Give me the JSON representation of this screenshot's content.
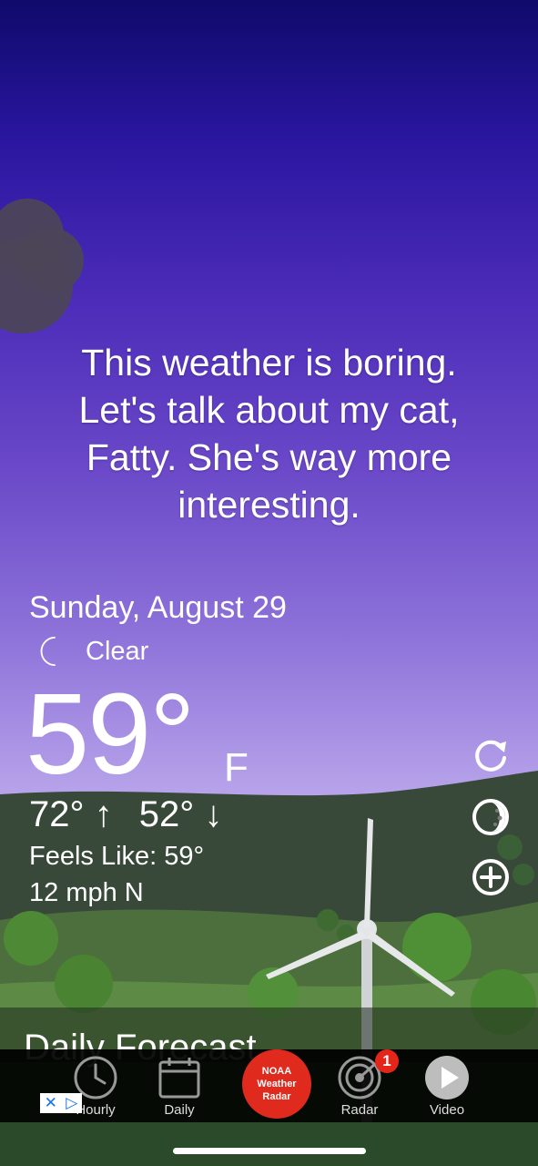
{
  "quote": {
    "lines": [
      "This weather is boring.",
      "Let's talk about my cat,",
      "Fatty. She's way more",
      "interesting."
    ]
  },
  "current": {
    "date": "Sunday, August 29",
    "condition": "Clear",
    "condition_icon": "moon-icon",
    "temperature": "59°",
    "unit": "F",
    "high": "72°",
    "low": "52°",
    "high_arrow": "↑",
    "low_arrow": "↓",
    "feels_like": "Feels Like: 59°",
    "wind": "12 mph N"
  },
  "side_actions": [
    {
      "name": "refresh-icon"
    },
    {
      "name": "theme-icon"
    },
    {
      "name": "add-location-icon"
    }
  ],
  "daily_forecast": {
    "title": "Daily Forecast"
  },
  "tabs": {
    "hourly": "Hourly",
    "daily": "Daily",
    "noaa": "NOAA Weather Radar",
    "radar": "Radar",
    "radar_badge": "1",
    "video": "Video"
  },
  "ad": {
    "close": "✕",
    "play": "▷"
  },
  "colors": {
    "accent_red": "#e02a1d",
    "moon_blue": "#2d6fe0",
    "sky_top": "#0f0a6b",
    "sky_bottom": "#d9cdf4"
  }
}
